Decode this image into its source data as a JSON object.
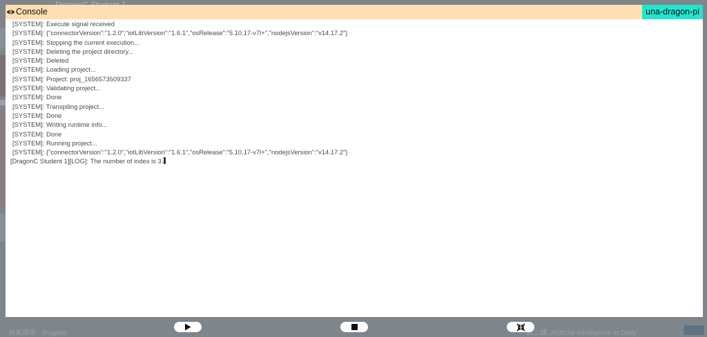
{
  "backdrop": {
    "title": "DragonC Student 1"
  },
  "console": {
    "title": "Console",
    "device": "una-dragon-pi",
    "lines": [
      "[SYSTEM]: Execute signal received",
      "[SYSTEM]: {\"connectorVersion\":\"1.2.0\",\"iotLibVersion\":\"1.6.1\",\"osRelease\":\"5.10.17-v7l+\",\"nodejsVersion\":\"v14.17.2\"}",
      "[SYSTEM]: Stopping the current execution...",
      "[SYSTEM]: Deleting the project directory...",
      "[SYSTEM]: Deleted",
      "[SYSTEM]: Loading project...",
      "[SYSTEM]: Project: proj_1656573509337",
      "[SYSTEM]: Validating project...",
      "[SYSTEM]: Done",
      "[SYSTEM]: Transpiling project...",
      "[SYSTEM]: Done",
      "[SYSTEM]: Writing runtime info...",
      "[SYSTEM]: Done",
      "[SYSTEM]: Running project...",
      "[SYSTEM]: {\"connectorVersion\":\"1.2.0\",\"iotLibVersion\":\"1.6.1\",\"osRelease\":\"5.10.17-v7l+\",\"nodejsVersion\":\"v14.17.2\"}",
      "[DragonC Student 1][LOG]: The number of index is 3."
    ]
  },
  "footer": {
    "left_text": "尚未保存 · dragonc",
    "right_text": "第二課: Artificial Intelligence in Daily",
    "buttons": [
      "play-icon",
      "stop-icon",
      "shrink-icon"
    ]
  },
  "colors": {
    "header_bg": "#ffdfb1",
    "badge_bg": "#22e5d1",
    "overlay": "#7f868b"
  }
}
